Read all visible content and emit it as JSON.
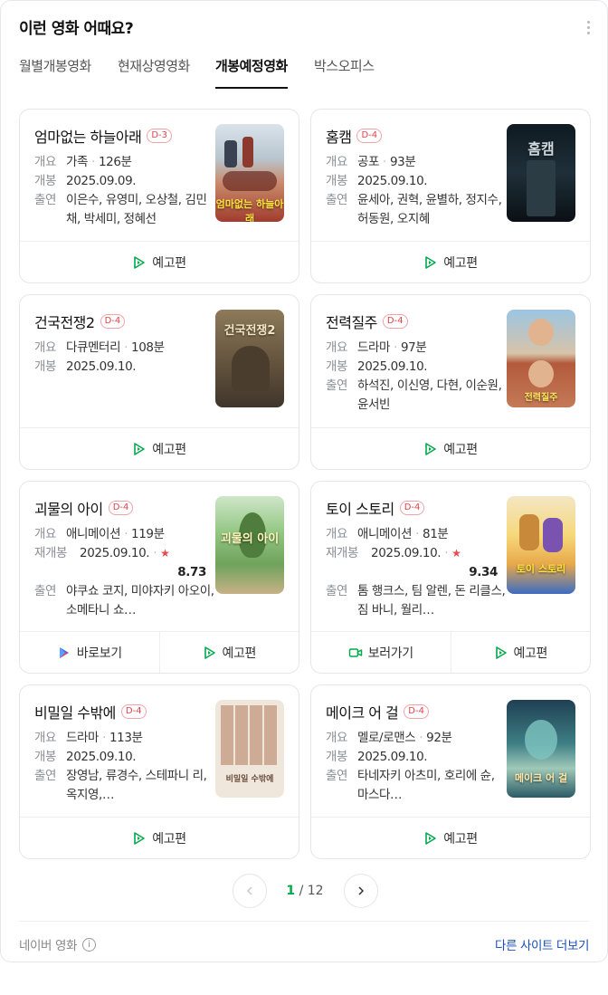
{
  "header": {
    "title": "이런 영화 어때요?"
  },
  "tabs": [
    {
      "label": "월별개봉영화"
    },
    {
      "label": "현재상영영화"
    },
    {
      "label": "개봉예정영화"
    },
    {
      "label": "박스오피스"
    }
  ],
  "movies": [
    {
      "title": "엄마없는 하늘아래",
      "badge": "D-3",
      "k1": "개요",
      "genre": "가족",
      "runtime": "126분",
      "k2": "개봉",
      "date": "2025.09.09.",
      "k3": "출연",
      "cast": "이은수, 유영미, 오상철, 김민채, 박세미, 정혜선",
      "poster_text": "엄마없는 하늘아래",
      "btn": "예고편"
    },
    {
      "title": "홈캠",
      "badge": "D-4",
      "k1": "개요",
      "genre": "공포",
      "runtime": "93분",
      "k2": "개봉",
      "date": "2025.09.10.",
      "k3": "출연",
      "cast": "윤세아, 권혁, 윤별하, 정지수, 허동원, 오지혜",
      "poster_text": "홈캠",
      "btn": "예고편"
    },
    {
      "title": "건국전쟁2",
      "badge": "D-4",
      "k1": "개요",
      "genre": "다큐멘터리",
      "runtime": "108분",
      "k2": "개봉",
      "date": "2025.09.10.",
      "poster_text": "건국전쟁2",
      "btn": "예고편"
    },
    {
      "title": "전력질주",
      "badge": "D-4",
      "k1": "개요",
      "genre": "드라마",
      "runtime": "97분",
      "k2": "개봉",
      "date": "2025.09.10.",
      "k3": "출연",
      "cast": "하석진, 이신영, 다현, 이순원, 윤서빈",
      "poster_text": "전력질주",
      "btn": "예고편"
    },
    {
      "title": "괴물의 아이",
      "badge": "D-4",
      "k1": "개요",
      "genre": "애니메이션",
      "runtime": "119분",
      "k2": "재개봉",
      "date": "2025.09.10.",
      "score": "8.73",
      "k3": "출연",
      "cast": "야쿠쇼 코지, 미야자키 아오이, 소메타니 쇼…",
      "poster_text": "괴물의 아이",
      "btn_watch": "바로보기",
      "btn": "예고편"
    },
    {
      "title": "토이 스토리",
      "badge": "D-4",
      "k1": "개요",
      "genre": "애니메이션",
      "runtime": "81분",
      "k2": "재개봉",
      "date": "2025.09.10.",
      "score": "9.34",
      "k3": "출연",
      "cast": "톰 행크스, 팀 알렌, 돈 리클스, 짐 바니, 월리…",
      "poster_text": "토이 스토리",
      "btn_watch": "보러가기",
      "btn": "예고편"
    },
    {
      "title": "비밀일 수밖에",
      "badge": "D-4",
      "k1": "개요",
      "genre": "드라마",
      "runtime": "113분",
      "k2": "개봉",
      "date": "2025.09.10.",
      "k3": "출연",
      "cast": "장영남, 류경수, 스테파니 리, 옥지영,…",
      "poster_text": "비밀일 수밖에",
      "btn": "예고편"
    },
    {
      "title": "메이크 어 걸",
      "badge": "D-4",
      "k1": "개요",
      "genre": "멜로/로맨스",
      "runtime": "92분",
      "k2": "개봉",
      "date": "2025.09.10.",
      "k3": "출연",
      "cast": "타네자키 아츠미, 호리에 슌, 마스다…",
      "poster_text": "메이크 어 걸",
      "btn": "예고편"
    }
  ],
  "pagination": {
    "current": "1",
    "separator": "/",
    "total": "12"
  },
  "footer": {
    "source": "네이버 영화",
    "info": "i",
    "more": "다른 사이트 더보기"
  },
  "colors": {
    "accent_green": "#03a94d",
    "badge_red": "#e0434a",
    "link_blue": "#1b4fb5"
  }
}
